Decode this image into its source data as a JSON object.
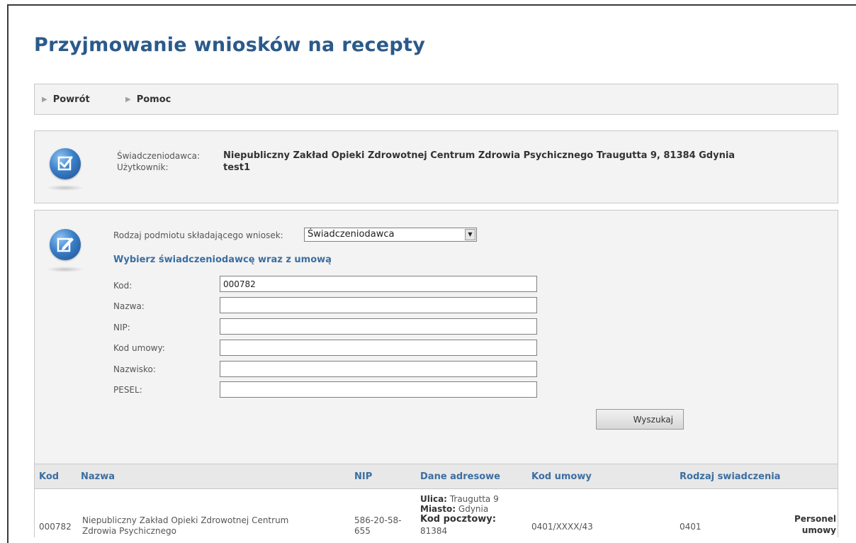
{
  "page": {
    "title": "Przyjmowanie wniosków na recepty"
  },
  "nav": {
    "back_label": "Powrót",
    "help_label": "Pomoc"
  },
  "info": {
    "provider_label": "Świadczeniodawca:",
    "provider_value": "Niepubliczny Zakład Opieki Zdrowotnej Centrum Zdrowia Psychicznego Traugutta 9, 81384 Gdynia",
    "user_label": "Użytkownik:",
    "user_value": "test1",
    "icon": "checkbox-form-icon"
  },
  "search": {
    "icon": "edit-form-icon",
    "entity_type_label": "Rodzaj podmiotu składającego wniosek:",
    "entity_type_value": "Świadczeniodawca",
    "heading": "Wybierz świadczeniodawcę wraz z umową",
    "fields": {
      "code_label": "Kod:",
      "code_value": "000782",
      "name_label": "Nazwa:",
      "name_value": "",
      "nip_label": "NIP:",
      "nip_value": "",
      "contract_label": "Kod umowy:",
      "contract_value": "",
      "surname_label": "Nazwisko:",
      "surname_value": "",
      "pesel_label": "PESEL:",
      "pesel_value": ""
    },
    "button_label": "Wyszukaj"
  },
  "table": {
    "columns": [
      "Kod",
      "Nazwa",
      "NIP",
      "Dane adresowe",
      "Kod umowy",
      "Rodzaj swiadczenia"
    ],
    "rows": [
      {
        "code": "000782",
        "name_line1": "Niepubliczny Zakład Opieki Zdrowotnej Centrum",
        "name_line2": "Zdrowia Psychicznego",
        "nip_line1": "586-20-58-",
        "nip_line2": "655",
        "street_label": "Ulica:",
        "street_value": "Traugutta 9",
        "city_label": "Miasto:",
        "city_value": "Gdynia",
        "postal_label": "Kod pocztowy:",
        "postal_value": "81384",
        "contract": "0401/XXXX/43",
        "service_type": "0401",
        "action_line1": "Personel",
        "action_line2": "umowy"
      }
    ]
  },
  "colors": {
    "title": "#2b5a8a",
    "accent": "#3c6ea0",
    "panel_bg": "#f3f3f3"
  }
}
